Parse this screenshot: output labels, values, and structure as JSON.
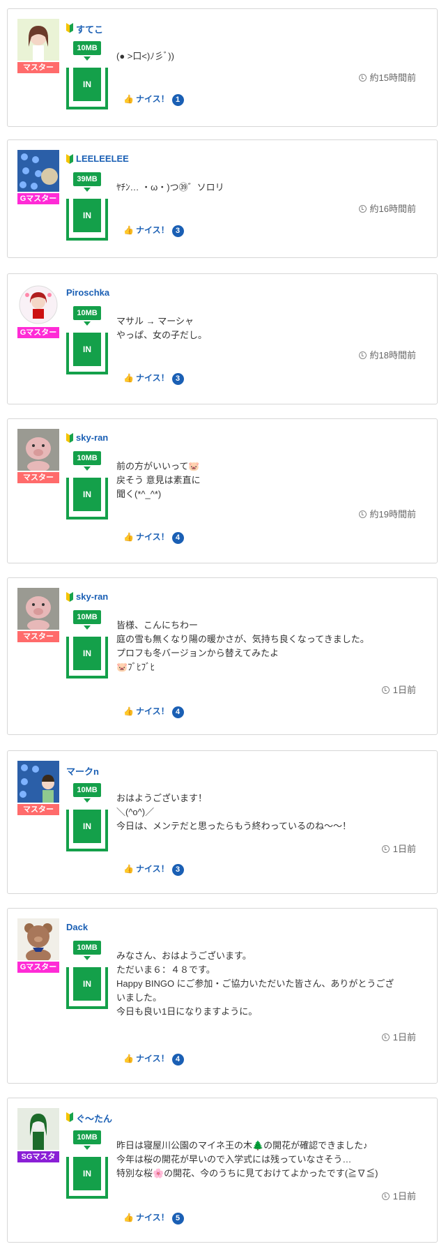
{
  "posts": [
    {
      "username": "すてこ",
      "beginner": true,
      "rank": "マスター",
      "rank_color": "#ff6b6b",
      "size": "10MB",
      "in_label": "IN",
      "message": [
        "(● >口<)ﾉ彡ﾞ))"
      ],
      "time": "約15時間前",
      "nice_label": "ナイス！",
      "nice_count": "1",
      "avatar_icon": "girl-avatar-icon"
    },
    {
      "username": "LEELEELEE",
      "beginner": true,
      "rank": "Gマスター",
      "rank_color": "#ff2bd6",
      "size": "39MB",
      "in_label": "IN",
      "message": [
        "ﾔﾁﾝ… ・ω・)つ㊴゛ソロリ"
      ],
      "time": "約16時間前",
      "nice_label": "ナイス！",
      "nice_count": "3",
      "avatar_icon": "flowers-avatar-icon"
    },
    {
      "username": "Piroschka",
      "beginner": false,
      "rank": "Gマスター",
      "rank_color": "#ff2bd6",
      "size": "10MB",
      "in_label": "IN",
      "message": [
        "マサル → マーシャ",
        "やっぱ、女の子だし。"
      ],
      "time": "約18時間前",
      "nice_label": "ナイス！",
      "nice_count": "3",
      "avatar_icon": "doll-avatar-icon"
    },
    {
      "username": "sky-ran",
      "beginner": true,
      "rank": "マスター",
      "rank_color": "#ff6b6b",
      "size": "10MB",
      "in_label": "IN",
      "message": [
        "前の方がいいって🐷",
        "戻そう 意見は素直に",
        "聞く(*^_^*)"
      ],
      "time": "約19時間前",
      "nice_label": "ナイス！",
      "nice_count": "4",
      "avatar_icon": "pig-avatar-icon"
    },
    {
      "username": "sky-ran",
      "beginner": true,
      "rank": "マスター",
      "rank_color": "#ff6b6b",
      "size": "10MB",
      "in_label": "IN",
      "message": [
        "皆様、こんにちわー",
        "庭の雪も無くなり陽の暖かさが、気持ち良くなってきました。",
        "プロフも冬バージョンから替えてみたよ",
        "🐷ﾌﾞﾋﾌﾞﾋ"
      ],
      "time": "1日前",
      "nice_label": "ナイス！",
      "nice_count": "4",
      "avatar_icon": "pig-avatar-icon"
    },
    {
      "username": "マークn",
      "beginner": false,
      "rank": "マスター",
      "rank_color": "#ff6b6b",
      "size": "10MB",
      "in_label": "IN",
      "message": [
        "おはようございます！",
        "＼(^o^)／",
        "今日は、メンテだと思ったらもう終わっているのね〜〜！"
      ],
      "time": "1日前",
      "nice_label": "ナイス！",
      "nice_count": "3",
      "avatar_icon": "man-flowers-avatar-icon"
    },
    {
      "username": "Dack",
      "beginner": false,
      "rank": "Gマスター",
      "rank_color": "#ff2bd6",
      "size": "10MB",
      "in_label": "IN",
      "message": [
        "みなさん、おはようございます。",
        "ただいま６：４８です。",
        "Happy BINGO にご参加・ご協力いただいた皆さん、ありがとうござ",
        "いました。",
        "今日も良い1日になりますように。"
      ],
      "time": "1日前",
      "nice_label": "ナイス！",
      "nice_count": "4",
      "avatar_icon": "teddy-bear-avatar-icon"
    },
    {
      "username": "ぐ〜たん",
      "beginner": true,
      "rank": "SGマスタ",
      "rank_color": "#8a1fd6",
      "size": "10MB",
      "in_label": "IN",
      "message": [
        "昨日は寝屋川公園のマイネ王の木🌲の開花が確認できました♪",
        "今年は桜の開花が早いので入学式には残っていなさそう…",
        "特別な桜🌸の開花、今のうちに見ておけてよかったです(≧∇≦)"
      ],
      "time": "1日前",
      "nice_label": "ナイス！",
      "nice_count": "5",
      "avatar_icon": "green-girl-avatar-icon"
    }
  ]
}
